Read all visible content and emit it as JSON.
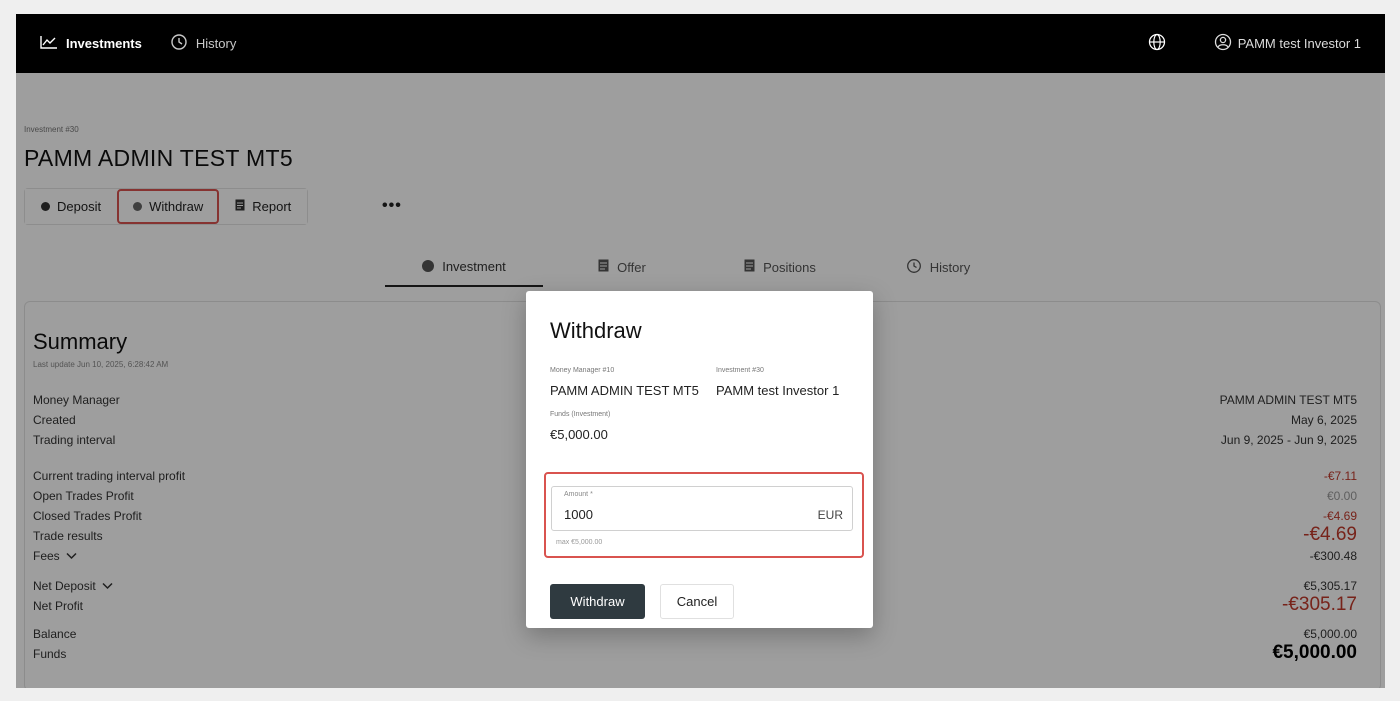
{
  "topbar": {
    "nav_investments": "Investments",
    "nav_history": "History",
    "user": "PAMM test Investor 1"
  },
  "page": {
    "breadcrumb": "Investment #30",
    "title": "PAMM ADMIN TEST MT5",
    "actions": {
      "deposit": "Deposit",
      "withdraw": "Withdraw",
      "report": "Report",
      "more": "•••"
    },
    "tabs": [
      "Investment",
      "Offer",
      "Positions",
      "History"
    ]
  },
  "summary": {
    "title": "Summary",
    "updated": "Last update Jun 10, 2025, 6:28:42 AM",
    "rows": {
      "money_manager": {
        "label": "Money Manager",
        "value": "PAMM ADMIN TEST MT5"
      },
      "created": {
        "label": "Created",
        "value": "May 6, 2025"
      },
      "trading_interval": {
        "label": "Trading interval",
        "value": "Jun 9, 2025 - Jun 9, 2025"
      },
      "current_profit": {
        "label": "Current trading interval profit",
        "value": "-€7.11"
      },
      "open_trades": {
        "label": "Open Trades Profit",
        "value": "€0.00"
      },
      "closed_trades": {
        "label": "Closed Trades Profit",
        "value": "-€4.69"
      },
      "trade_results": {
        "label": "Trade results",
        "value": "-€4.69"
      },
      "fees": {
        "label": "Fees",
        "value": "-€300.48"
      },
      "net_deposit": {
        "label": "Net Deposit",
        "value": "€5,305.17"
      },
      "net_profit": {
        "label": "Net Profit",
        "value": "-€305.17"
      },
      "balance": {
        "label": "Balance",
        "value": "€5,000.00"
      },
      "funds": {
        "label": "Funds",
        "value": "€5,000.00"
      }
    }
  },
  "modal": {
    "title": "Withdraw",
    "money_manager_label": "Money Manager #10",
    "money_manager_value": "PAMM ADMIN TEST MT5",
    "investment_label": "Investment #30",
    "investment_value": "PAMM test Investor 1",
    "funds_label": "Funds (Investment)",
    "funds_value": "€5,000.00",
    "amount_label": "Amount *",
    "amount_value": "1000",
    "currency": "EUR",
    "amount_hint": "max €5,000.00",
    "submit": "Withdraw",
    "cancel": "Cancel"
  },
  "colors": {
    "topbar": "#000000",
    "negative": "#c0392b",
    "highlight": "#d9534f",
    "primary_button": "#2f3a40"
  },
  "icons": [
    "chart-line-icon",
    "history-icon",
    "globe-icon",
    "user-circle-icon",
    "coin-icon",
    "document-icon"
  ]
}
